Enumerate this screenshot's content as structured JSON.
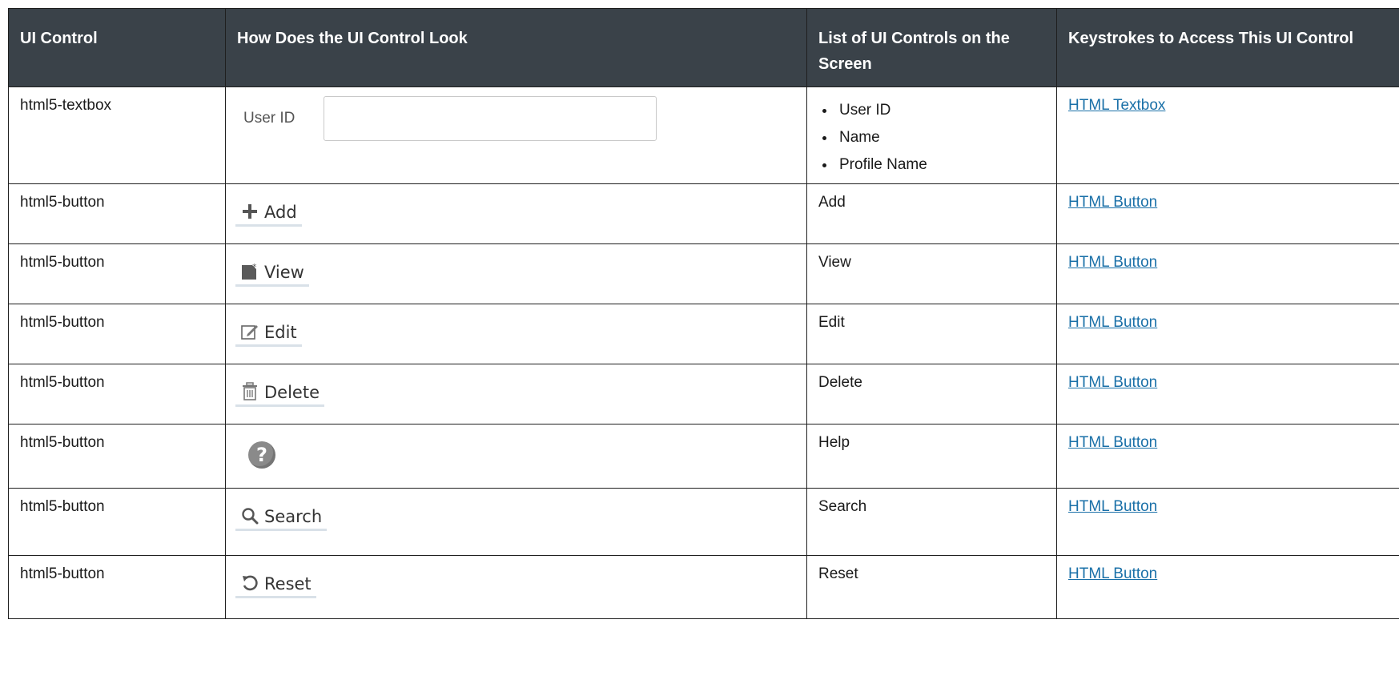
{
  "headers": [
    "UI Control",
    "How Does the UI Control Look",
    "List of UI Controls on the Screen",
    "Keystrokes to Access This UI Control"
  ],
  "rows": [
    {
      "control": "html5-textbox",
      "look": {
        "kind": "textbox",
        "label": "User ID"
      },
      "list": [
        "User ID",
        "Name",
        "Profile Name"
      ],
      "keystroke": "HTML Textbox"
    },
    {
      "control": "html5-button",
      "look": {
        "kind": "button",
        "icon": "plus-icon",
        "label": "Add"
      },
      "list": "Add",
      "keystroke": "HTML Button"
    },
    {
      "control": "html5-button",
      "look": {
        "kind": "button",
        "icon": "view-icon",
        "label": "View"
      },
      "list": "View",
      "keystroke": "HTML Button"
    },
    {
      "control": "html5-button",
      "look": {
        "kind": "button",
        "icon": "edit-icon",
        "label": "Edit"
      },
      "list": "Edit",
      "keystroke": "HTML Button"
    },
    {
      "control": "html5-button",
      "look": {
        "kind": "button",
        "icon": "trash-icon",
        "label": "Delete"
      },
      "list": "Delete",
      "keystroke": "HTML Button"
    },
    {
      "control": "html5-button",
      "look": {
        "kind": "help",
        "icon": "help-icon",
        "label": "?"
      },
      "list": "Help",
      "keystroke": "HTML Button"
    },
    {
      "control": "html5-button",
      "look": {
        "kind": "button",
        "icon": "search-icon",
        "label": "Search"
      },
      "list": "Search",
      "keystroke": "HTML Button"
    },
    {
      "control": "html5-button",
      "look": {
        "kind": "button",
        "icon": "reset-icon",
        "label": "Reset"
      },
      "list": "Reset",
      "keystroke": "HTML Button"
    }
  ],
  "colors": {
    "header_bg": "#3a4249",
    "link": "#1a70a8",
    "border": "#1f1f1f"
  }
}
